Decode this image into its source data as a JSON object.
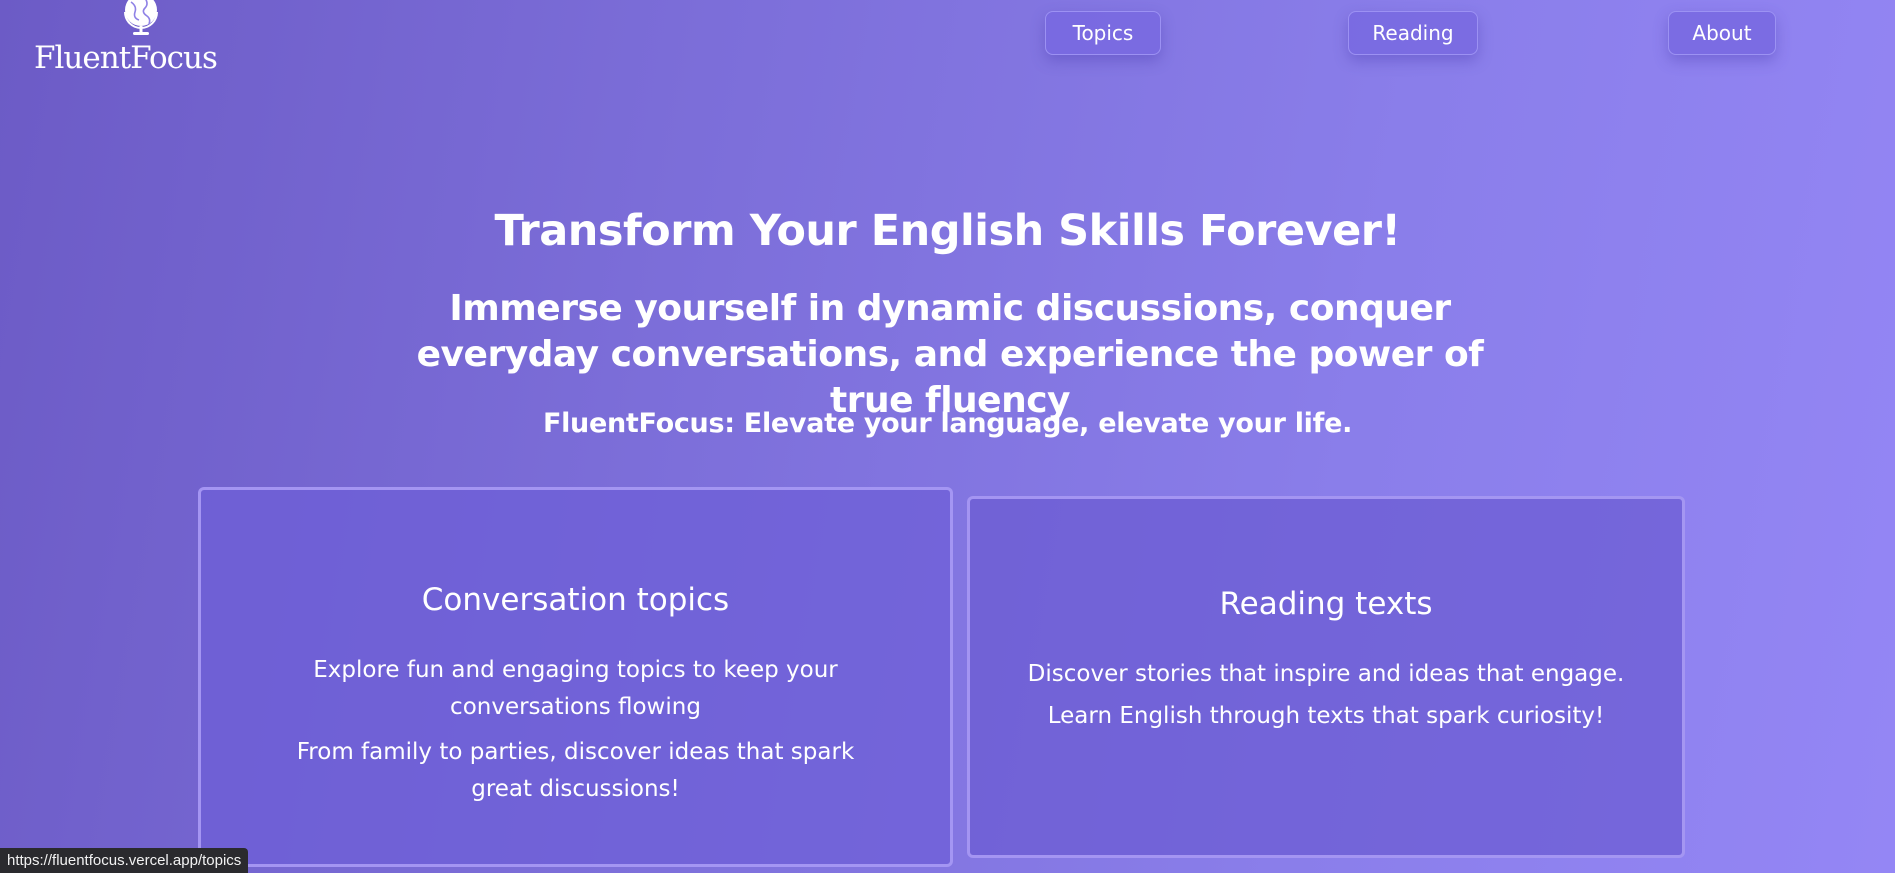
{
  "header": {
    "logo_icon": "globe-icon",
    "logo_text": "FluentFocus",
    "nav": {
      "topics": "Topics",
      "reading": "Reading",
      "about": "About"
    }
  },
  "hero": {
    "title": "Transform Your English Skills Forever!",
    "subtitle": "Immerse yourself in dynamic discussions, conquer everyday conversations, and experience the power of true fluency",
    "tagline": "FluentFocus: Elevate your language, elevate your life."
  },
  "cards": {
    "topics": {
      "title": "Conversation topics",
      "text1": "Explore fun and engaging topics to keep your conversations flowing",
      "text2": "From family to parties, discover ideas that spark great discussions!"
    },
    "reading": {
      "title": "Reading texts",
      "text1": "Discover stories that inspire and ideas that engage.",
      "text2": "Learn English through texts that spark curiosity!"
    }
  },
  "status_bar": {
    "url": "https://fluentfocus.vercel.app/topics"
  },
  "colors": {
    "background_start": "#6c5bc6",
    "background_end": "#9486f5",
    "text": "#ffffff",
    "card_border": "#aa9bf5"
  }
}
